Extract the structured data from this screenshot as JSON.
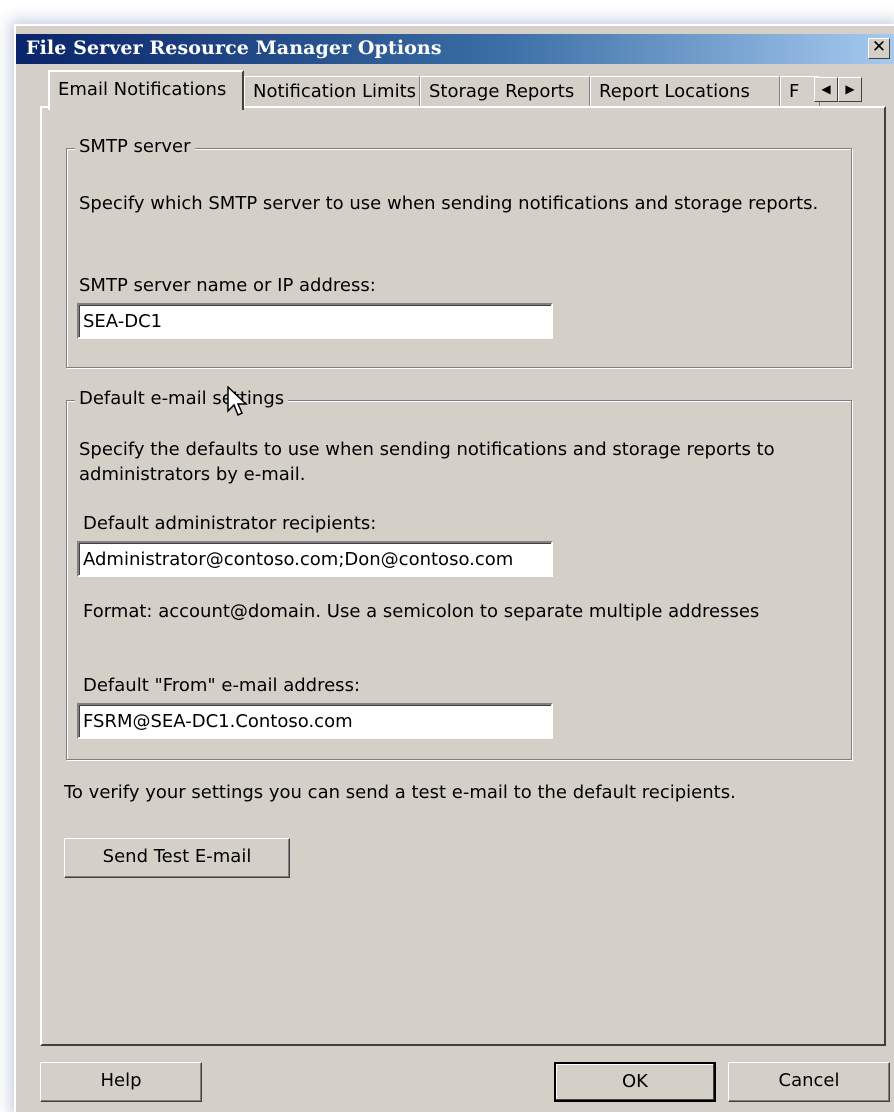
{
  "window": {
    "title": "File Server Resource Manager Options",
    "close_glyph": "✕"
  },
  "tabs": [
    {
      "label": "Email Notifications"
    },
    {
      "label": "Notification Limits"
    },
    {
      "label": "Storage Reports"
    },
    {
      "label": "Report Locations"
    },
    {
      "label": "F"
    }
  ],
  "tab_scroll": {
    "left_icon": "arrow-left-icon",
    "right_icon": "arrow-right-icon",
    "left": "◀",
    "right": "▶"
  },
  "smtp": {
    "group_label": "SMTP server",
    "description": "Specify which SMTP server to use when sending notifications and storage reports.",
    "server_label": "SMTP server name or IP address:",
    "server_value": "SEA-DC1"
  },
  "defaults": {
    "group_label": "Default e-mail settings",
    "description": "Specify the defaults to use when sending notifications and storage reports to administrators by e-mail.",
    "recipients_label": "Default administrator recipients:",
    "recipients_value": "Administrator@contoso.com;Don@contoso.com",
    "format_hint": "Format: account@domain. Use a semicolon to separate multiple addresses",
    "from_label": "Default \"From\" e-mail address:",
    "from_value": "FSRM@SEA-DC1.Contoso.com"
  },
  "verify_text": "To verify your settings you can send a test e-mail to the default recipients.",
  "send_test_label": "Send Test E-mail",
  "footer": {
    "help": "Help",
    "ok": "OK",
    "cancel": "Cancel"
  }
}
